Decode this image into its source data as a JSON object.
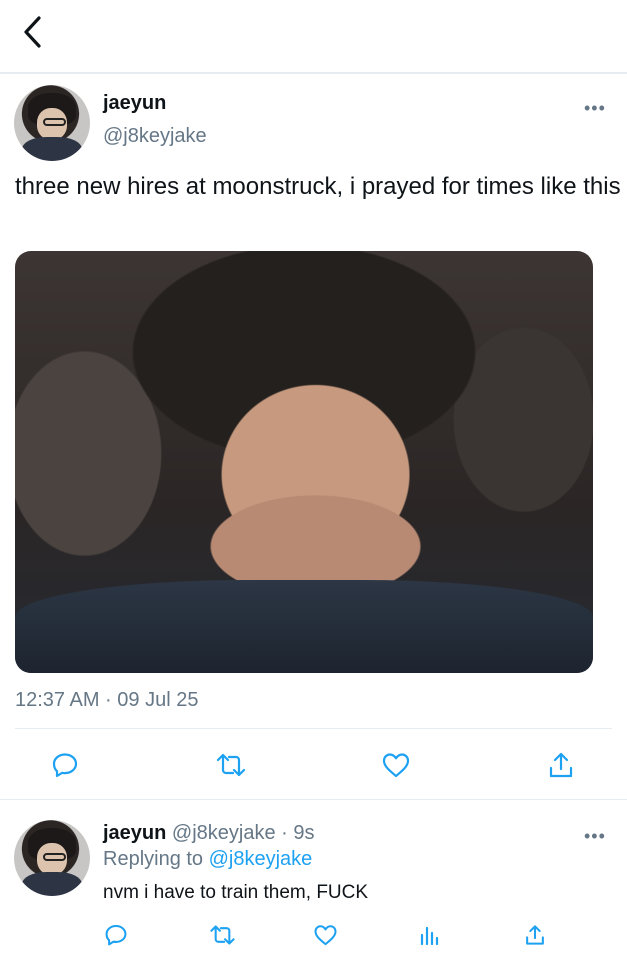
{
  "tweet": {
    "author": {
      "name": "jaeyun",
      "handle": "@j8keyjake"
    },
    "text": "three new hires at moonstruck, i prayed for times like this",
    "timestamp": "12:37 AM · 09 Jul 25",
    "more_label": "•••"
  },
  "reply": {
    "author": {
      "name": "jaeyun",
      "handle": "@j8keyjake",
      "time": "· 9s"
    },
    "replying_label": "Replying to",
    "replying_to": "@j8keyjake",
    "text": "nvm i have to train them, FUCK",
    "more_label": "•••"
  },
  "icons": {
    "back": "chevron-left-icon",
    "reply": "comment-icon",
    "retweet": "retweet-icon",
    "like": "heart-icon",
    "share": "share-icon",
    "analytics": "analytics-icon"
  },
  "colors": {
    "icon": "#657786",
    "link": "#1da1f2",
    "divider": "#e6ecf0",
    "text": "#0f1419"
  }
}
